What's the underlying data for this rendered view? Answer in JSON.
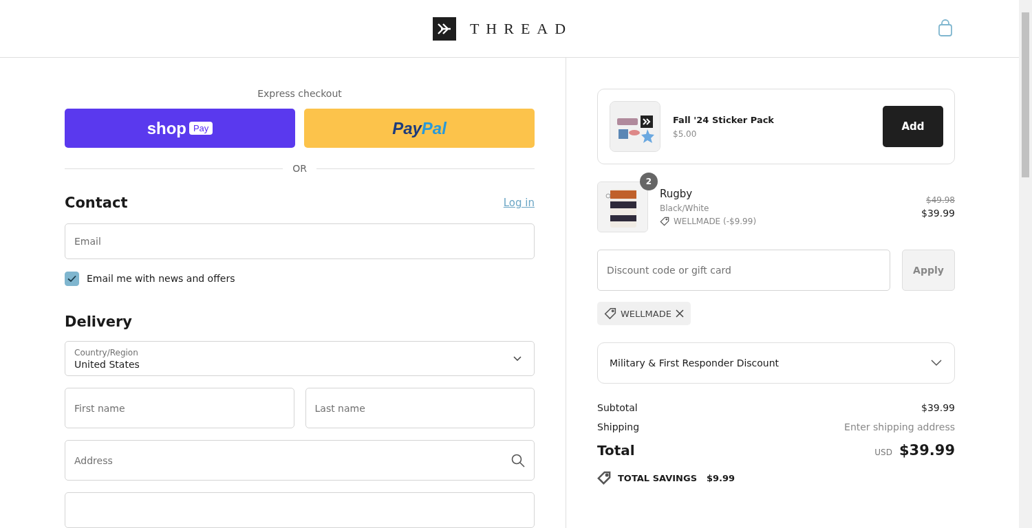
{
  "header": {
    "brand": "THREAD"
  },
  "checkout": {
    "express_title": "Express checkout",
    "shop_pay": {
      "word": "shop",
      "badge": "Pay"
    },
    "paypal": {
      "first": "Pay",
      "second": "Pal"
    },
    "divider": "OR",
    "contact": {
      "title": "Contact",
      "login": "Log in",
      "email": {
        "placeholder": "Email"
      },
      "newsletter": {
        "label": "Email me with news and offers",
        "checked": true
      }
    },
    "delivery": {
      "title": "Delivery",
      "country": {
        "label": "Country/Region",
        "value": "United States"
      },
      "first_name": {
        "placeholder": "First name"
      },
      "last_name": {
        "placeholder": "Last name"
      },
      "address": {
        "placeholder": "Address"
      }
    }
  },
  "summary": {
    "upsell": {
      "name": "Fall '24 Sticker Pack",
      "price": "$5.00",
      "button": "Add"
    },
    "items": [
      {
        "name": "Rugby",
        "variant": "Black/White",
        "discount": "WELLMADE (-$9.99)",
        "quantity": "2",
        "original_price": "$49.98",
        "price": "$39.99"
      }
    ],
    "discount_field": {
      "placeholder": "Discount code or gift card"
    },
    "apply_button": "Apply",
    "applied_codes": [
      "WELLMADE"
    ],
    "military": {
      "label": "Military & First Responder Discount",
      "expanded": false
    },
    "rows": [
      {
        "label": "Subtotal",
        "value": "$39.99",
        "kind": "amount"
      },
      {
        "label": "Shipping",
        "value": "Enter shipping address",
        "kind": "note"
      }
    ],
    "total": {
      "label": "Total",
      "currency": "USD",
      "value": "$39.99"
    },
    "savings": {
      "label": "TOTAL SAVINGS",
      "value": "$9.99"
    }
  }
}
